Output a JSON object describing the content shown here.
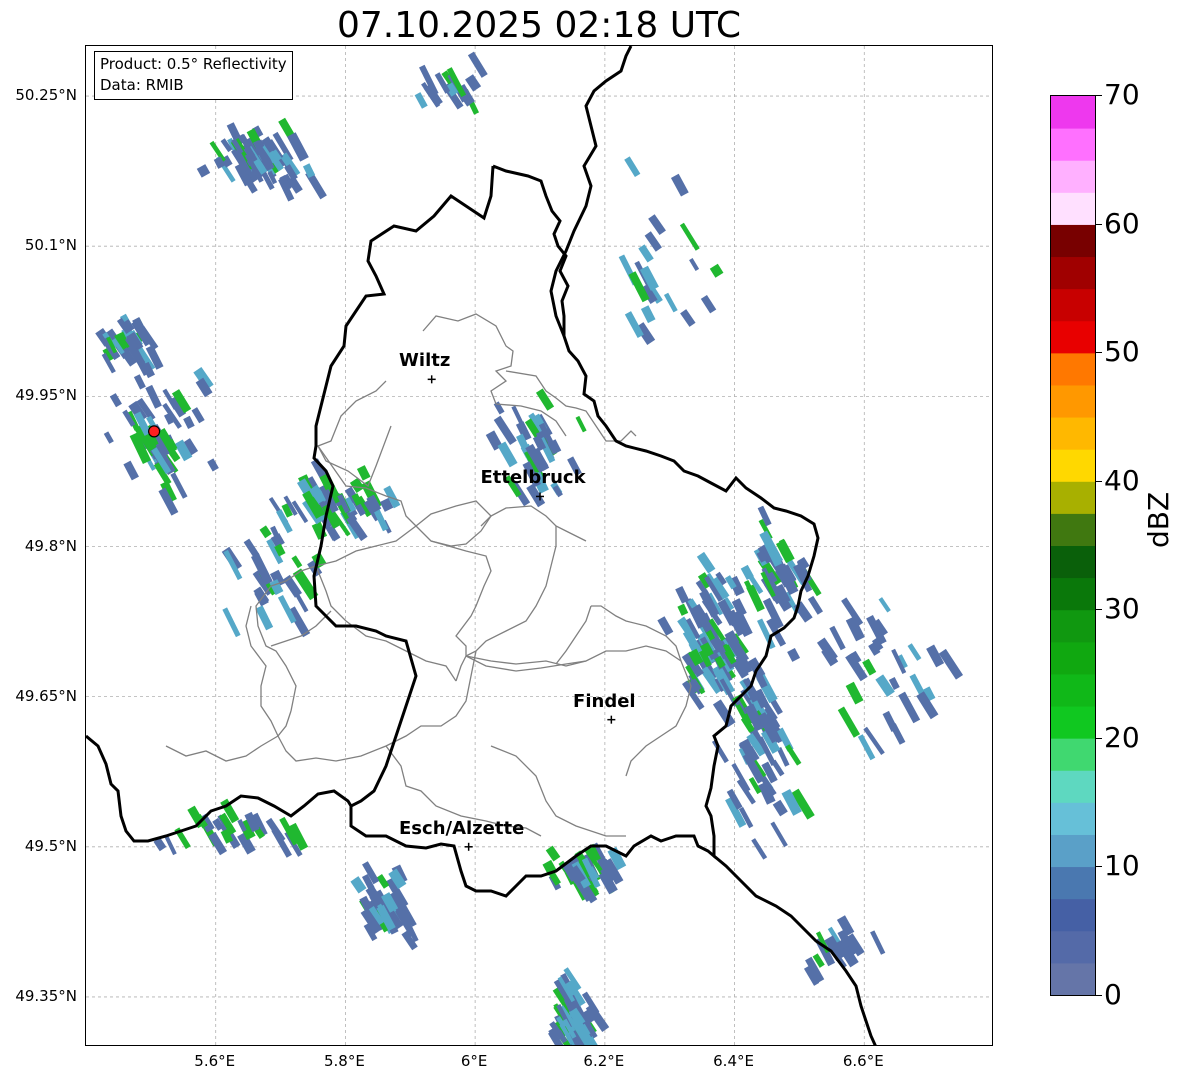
{
  "title": "07.10.2025 02:18 UTC",
  "product": {
    "line1": "Product: 0.5° Reflectivity",
    "line2": "Data: RMIB"
  },
  "axes": {
    "lat_labels": [
      "50.25°N",
      "50.1°N",
      "49.95°N",
      "49.8°N",
      "49.65°N",
      "49.5°N",
      "49.35°N"
    ],
    "lon_labels": [
      "5.6°E",
      "5.8°E",
      "6°E",
      "6.2°E",
      "6.4°E",
      "6.6°E"
    ],
    "lat_values": [
      50.25,
      50.1,
      49.95,
      49.8,
      49.65,
      49.5,
      49.35
    ],
    "lon_values": [
      5.6,
      5.8,
      6.0,
      6.2,
      6.4,
      6.6
    ],
    "lon_range": [
      5.4,
      6.8
    ],
    "lat_range": [
      49.3,
      50.3
    ],
    "grid": true
  },
  "cities": [
    {
      "name": "Wiltz",
      "lon": 5.933,
      "lat": 49.967
    },
    {
      "name": "Ettelbruck",
      "lon": 6.1,
      "lat": 49.85
    },
    {
      "name": "Findel",
      "lon": 6.21,
      "lat": 49.627
    },
    {
      "name": "Esch/Alzette",
      "lon": 5.99,
      "lat": 49.5
    }
  ],
  "radar_site": {
    "lon": 5.505,
    "lat": 49.915,
    "color": "#ff2020"
  },
  "colorbar": {
    "label": "dBZ",
    "ticks": [
      "0",
      "10",
      "20",
      "30",
      "40",
      "50",
      "60",
      "70"
    ],
    "colors": [
      "#6575a8",
      "#546aa8",
      "#4560a5",
      "#4a78b0",
      "#5aa0c8",
      "#66c0d8",
      "#5ed8c0",
      "#40d870",
      "#10c820",
      "#10b818",
      "#10a810",
      "#109810",
      "#0a780a",
      "#0a600a",
      "#407810",
      "#a8b000",
      "#ffd800",
      "#ffb800",
      "#ff9800",
      "#ff7800",
      "#e80000",
      "#c80000",
      "#a00000",
      "#780000",
      "#ffe0ff",
      "#ffb0ff",
      "#ff70ff",
      "#ee38ee"
    ]
  },
  "echo_colors": {
    "weak": "#5570a8",
    "light": "#55a8c8",
    "moderate": "#20b830",
    "strong": "#e8c800"
  },
  "echo_cells": [
    {
      "lon": 6.35,
      "lat": 49.72,
      "n": 70,
      "sx": 0.06,
      "sy": 0.06
    },
    {
      "lon": 6.43,
      "lat": 49.62,
      "n": 60,
      "sx": 0.05,
      "sy": 0.08
    },
    {
      "lon": 6.45,
      "lat": 49.78,
      "n": 40,
      "sx": 0.05,
      "sy": 0.05
    },
    {
      "lon": 6.14,
      "lat": 49.33,
      "n": 60,
      "sx": 0.03,
      "sy": 0.04
    },
    {
      "lon": 6.15,
      "lat": 49.48,
      "n": 40,
      "sx": 0.05,
      "sy": 0.02
    },
    {
      "lon": 5.65,
      "lat": 50.19,
      "n": 60,
      "sx": 0.07,
      "sy": 0.03
    },
    {
      "lon": 5.5,
      "lat": 49.92,
      "n": 50,
      "sx": 0.07,
      "sy": 0.07
    },
    {
      "lon": 5.78,
      "lat": 49.85,
      "n": 50,
      "sx": 0.08,
      "sy": 0.03
    },
    {
      "lon": 5.85,
      "lat": 49.45,
      "n": 35,
      "sx": 0.04,
      "sy": 0.03
    },
    {
      "lon": 6.08,
      "lat": 49.9,
      "n": 35,
      "sx": 0.06,
      "sy": 0.05
    },
    {
      "lon": 6.62,
      "lat": 49.68,
      "n": 30,
      "sx": 0.08,
      "sy": 0.06
    },
    {
      "lon": 5.45,
      "lat": 50.02,
      "n": 25,
      "sx": 0.04,
      "sy": 0.03
    },
    {
      "lon": 5.62,
      "lat": 49.52,
      "n": 25,
      "sx": 0.1,
      "sy": 0.02
    },
    {
      "lon": 5.68,
      "lat": 49.78,
      "n": 25,
      "sx": 0.06,
      "sy": 0.04
    },
    {
      "lon": 6.28,
      "lat": 50.08,
      "n": 20,
      "sx": 0.08,
      "sy": 0.1
    },
    {
      "lon": 5.95,
      "lat": 50.27,
      "n": 15,
      "sx": 0.05,
      "sy": 0.02
    },
    {
      "lon": 6.55,
      "lat": 49.4,
      "n": 15,
      "sx": 0.05,
      "sy": 0.03
    }
  ]
}
